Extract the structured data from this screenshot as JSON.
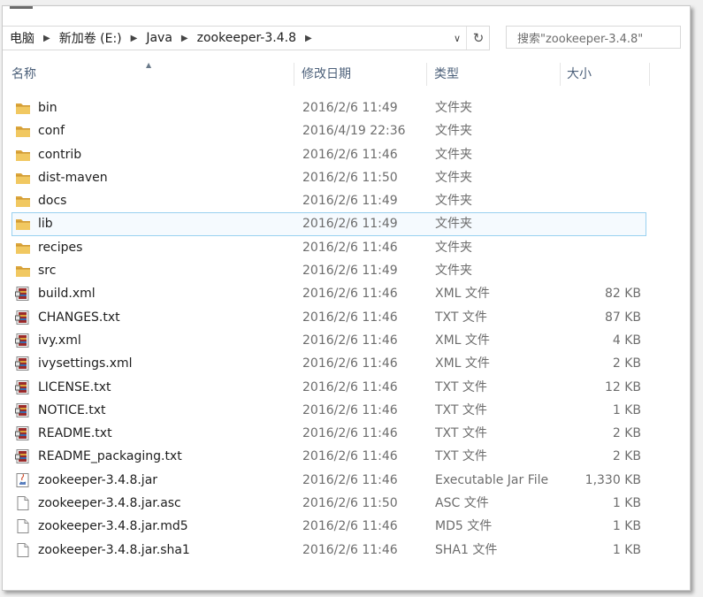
{
  "address": {
    "crumbs": [
      "电脑",
      "新加卷 (E:)",
      "Java",
      "zookeeper-3.4.8"
    ],
    "dropdown_glyph": "∨",
    "refresh_glyph": "↻"
  },
  "search": {
    "placeholder": "搜索\"zookeeper-3.4.8\""
  },
  "columns": {
    "name": "名称",
    "date": "修改日期",
    "type": "类型",
    "size": "大小"
  },
  "colors": {
    "selection_bg": "#f5fafe",
    "selection_border": "#99d1f0",
    "header_text": "#4c607a",
    "folder": "#e8b84a"
  },
  "files": [
    {
      "name": "bin",
      "date": "2016/2/6 11:49",
      "type": "文件夹",
      "size": "",
      "icon": "folder-icon"
    },
    {
      "name": "conf",
      "date": "2016/4/19 22:36",
      "type": "文件夹",
      "size": "",
      "icon": "folder-icon"
    },
    {
      "name": "contrib",
      "date": "2016/2/6 11:46",
      "type": "文件夹",
      "size": "",
      "icon": "folder-icon"
    },
    {
      "name": "dist-maven",
      "date": "2016/2/6 11:50",
      "type": "文件夹",
      "size": "",
      "icon": "folder-icon"
    },
    {
      "name": "docs",
      "date": "2016/2/6 11:49",
      "type": "文件夹",
      "size": "",
      "icon": "folder-icon"
    },
    {
      "name": "lib",
      "date": "2016/2/6 11:49",
      "type": "文件夹",
      "size": "",
      "icon": "folder-icon",
      "selected": true
    },
    {
      "name": "recipes",
      "date": "2016/2/6 11:46",
      "type": "文件夹",
      "size": "",
      "icon": "folder-icon"
    },
    {
      "name": "src",
      "date": "2016/2/6 11:49",
      "type": "文件夹",
      "size": "",
      "icon": "folder-icon"
    },
    {
      "name": "build.xml",
      "date": "2016/2/6 11:46",
      "type": "XML 文件",
      "size": "82 KB",
      "icon": "winrar-file-icon"
    },
    {
      "name": "CHANGES.txt",
      "date": "2016/2/6 11:46",
      "type": "TXT 文件",
      "size": "87 KB",
      "icon": "winrar-file-icon"
    },
    {
      "name": "ivy.xml",
      "date": "2016/2/6 11:46",
      "type": "XML 文件",
      "size": "4 KB",
      "icon": "winrar-file-icon"
    },
    {
      "name": "ivysettings.xml",
      "date": "2016/2/6 11:46",
      "type": "XML 文件",
      "size": "2 KB",
      "icon": "winrar-file-icon"
    },
    {
      "name": "LICENSE.txt",
      "date": "2016/2/6 11:46",
      "type": "TXT 文件",
      "size": "12 KB",
      "icon": "winrar-file-icon"
    },
    {
      "name": "NOTICE.txt",
      "date": "2016/2/6 11:46",
      "type": "TXT 文件",
      "size": "1 KB",
      "icon": "winrar-file-icon"
    },
    {
      "name": "README.txt",
      "date": "2016/2/6 11:46",
      "type": "TXT 文件",
      "size": "2 KB",
      "icon": "winrar-file-icon"
    },
    {
      "name": "README_packaging.txt",
      "date": "2016/2/6 11:46",
      "type": "TXT 文件",
      "size": "2 KB",
      "icon": "winrar-file-icon"
    },
    {
      "name": "zookeeper-3.4.8.jar",
      "date": "2016/2/6 11:46",
      "type": "Executable Jar File",
      "size": "1,330 KB",
      "icon": "java-jar-icon"
    },
    {
      "name": "zookeeper-3.4.8.jar.asc",
      "date": "2016/2/6 11:50",
      "type": "ASC 文件",
      "size": "1 KB",
      "icon": "blank-file-icon"
    },
    {
      "name": "zookeeper-3.4.8.jar.md5",
      "date": "2016/2/6 11:46",
      "type": "MD5 文件",
      "size": "1 KB",
      "icon": "blank-file-icon"
    },
    {
      "name": "zookeeper-3.4.8.jar.sha1",
      "date": "2016/2/6 11:46",
      "type": "SHA1 文件",
      "size": "1 KB",
      "icon": "blank-file-icon"
    }
  ]
}
